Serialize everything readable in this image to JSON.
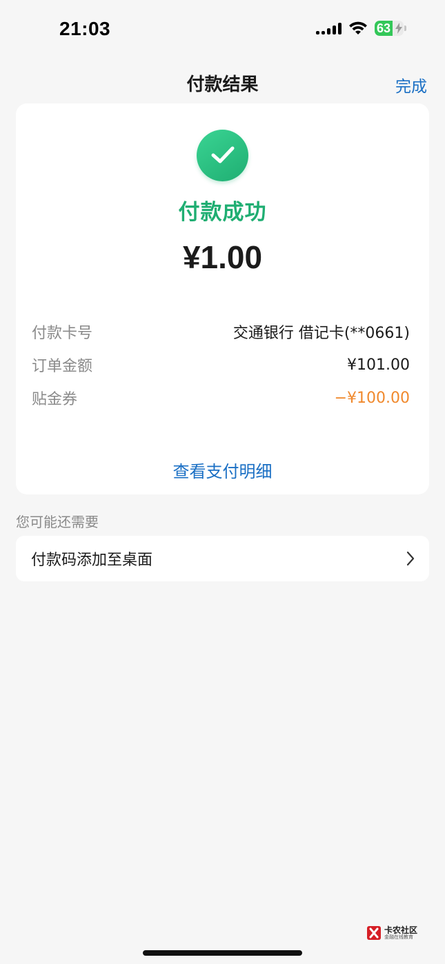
{
  "status_bar": {
    "time": "21:03",
    "battery_percent": 63,
    "battery_text": "63",
    "icons": [
      "signal-icon",
      "wifi-icon",
      "battery-charging-icon"
    ]
  },
  "header": {
    "title": "付款结果",
    "done_label": "完成"
  },
  "result": {
    "status_text": "付款成功",
    "amount": "¥1.00",
    "success_color": "#1fae72",
    "details": [
      {
        "label": "付款卡号",
        "value": "交通银行 借记卡(**0661)"
      },
      {
        "label": "订单金额",
        "value": "¥101.00"
      },
      {
        "label": "贴金券",
        "value": "−¥100.00",
        "value_color": "#f0892d"
      }
    ],
    "view_detail_label": "查看支付明细"
  },
  "suggestions": {
    "section_title": "您可能还需要",
    "items": [
      {
        "label": "付款码添加至桌面",
        "icon": "chevron-right-icon"
      }
    ]
  },
  "watermark": {
    "title": "卡农社区",
    "subtitle": "金融在线教育"
  },
  "colors": {
    "link": "#1a6fc4",
    "background": "#f6f6f6",
    "card": "#ffffff",
    "discount": "#f0892d"
  }
}
